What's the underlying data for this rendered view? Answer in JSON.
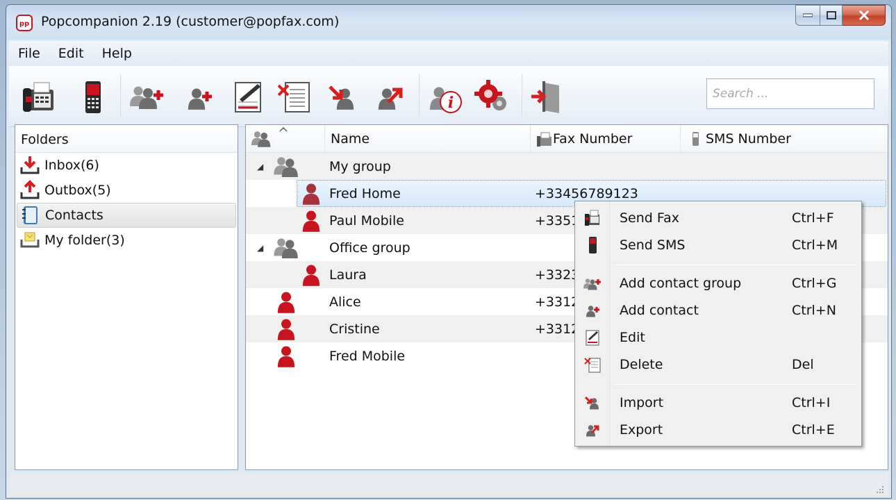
{
  "window": {
    "title": "Popcompanion 2.19 (customer@popfax.com)"
  },
  "menu": [
    "File",
    "Edit",
    "Help"
  ],
  "toolbar": {
    "buttons": [
      "send-fax",
      "send-sms",
      "add-contact-group",
      "add-contact",
      "edit",
      "delete",
      "import",
      "export",
      "about",
      "settings",
      "exit"
    ],
    "search_placeholder": "Search ..."
  },
  "folders": {
    "header": "Folders",
    "items": [
      {
        "label": "Inbox(6)",
        "icon": "inbox-icon"
      },
      {
        "label": "Outbox(5)",
        "icon": "outbox-icon"
      },
      {
        "label": "Contacts",
        "icon": "contacts-book-icon",
        "selected": true
      },
      {
        "label": "My folder(3)",
        "icon": "folder-icon"
      }
    ]
  },
  "contacts": {
    "columns": [
      "Name",
      "Fax Number",
      "SMS Number"
    ],
    "rows": [
      {
        "type": "group",
        "name": "My group",
        "fax": ""
      },
      {
        "type": "contact",
        "name": "Fred Home",
        "fax": "+33456789123",
        "selected": true
      },
      {
        "type": "contact",
        "name": "Paul Mobile",
        "fax": "+3351"
      },
      {
        "type": "group",
        "name": "Office group",
        "fax": ""
      },
      {
        "type": "contact",
        "name": "Laura",
        "fax": "+3323"
      },
      {
        "type": "contact",
        "name": "Alice",
        "fax": "+3312"
      },
      {
        "type": "contact",
        "name": "Cristine",
        "fax": "+3312"
      },
      {
        "type": "contact",
        "name": "Fred Mobile",
        "fax": ""
      }
    ]
  },
  "context_menu": {
    "items": [
      {
        "label": "Send Fax",
        "shortcut": "Ctrl+F"
      },
      {
        "label": "Send SMS",
        "shortcut": "Ctrl+M"
      },
      {
        "label": "Add contact group",
        "shortcut": "Ctrl+G"
      },
      {
        "label": "Add contact",
        "shortcut": "Ctrl+N"
      },
      {
        "label": "Edit",
        "shortcut": ""
      },
      {
        "label": "Delete",
        "shortcut": "Del"
      },
      {
        "label": "Import",
        "shortcut": "Ctrl+I"
      },
      {
        "label": "Export",
        "shortcut": "Ctrl+E"
      }
    ]
  },
  "colors": {
    "contact_red": "#c8141e",
    "group_gray": "#7a7a7a",
    "accent_red": "#d81f1f"
  }
}
